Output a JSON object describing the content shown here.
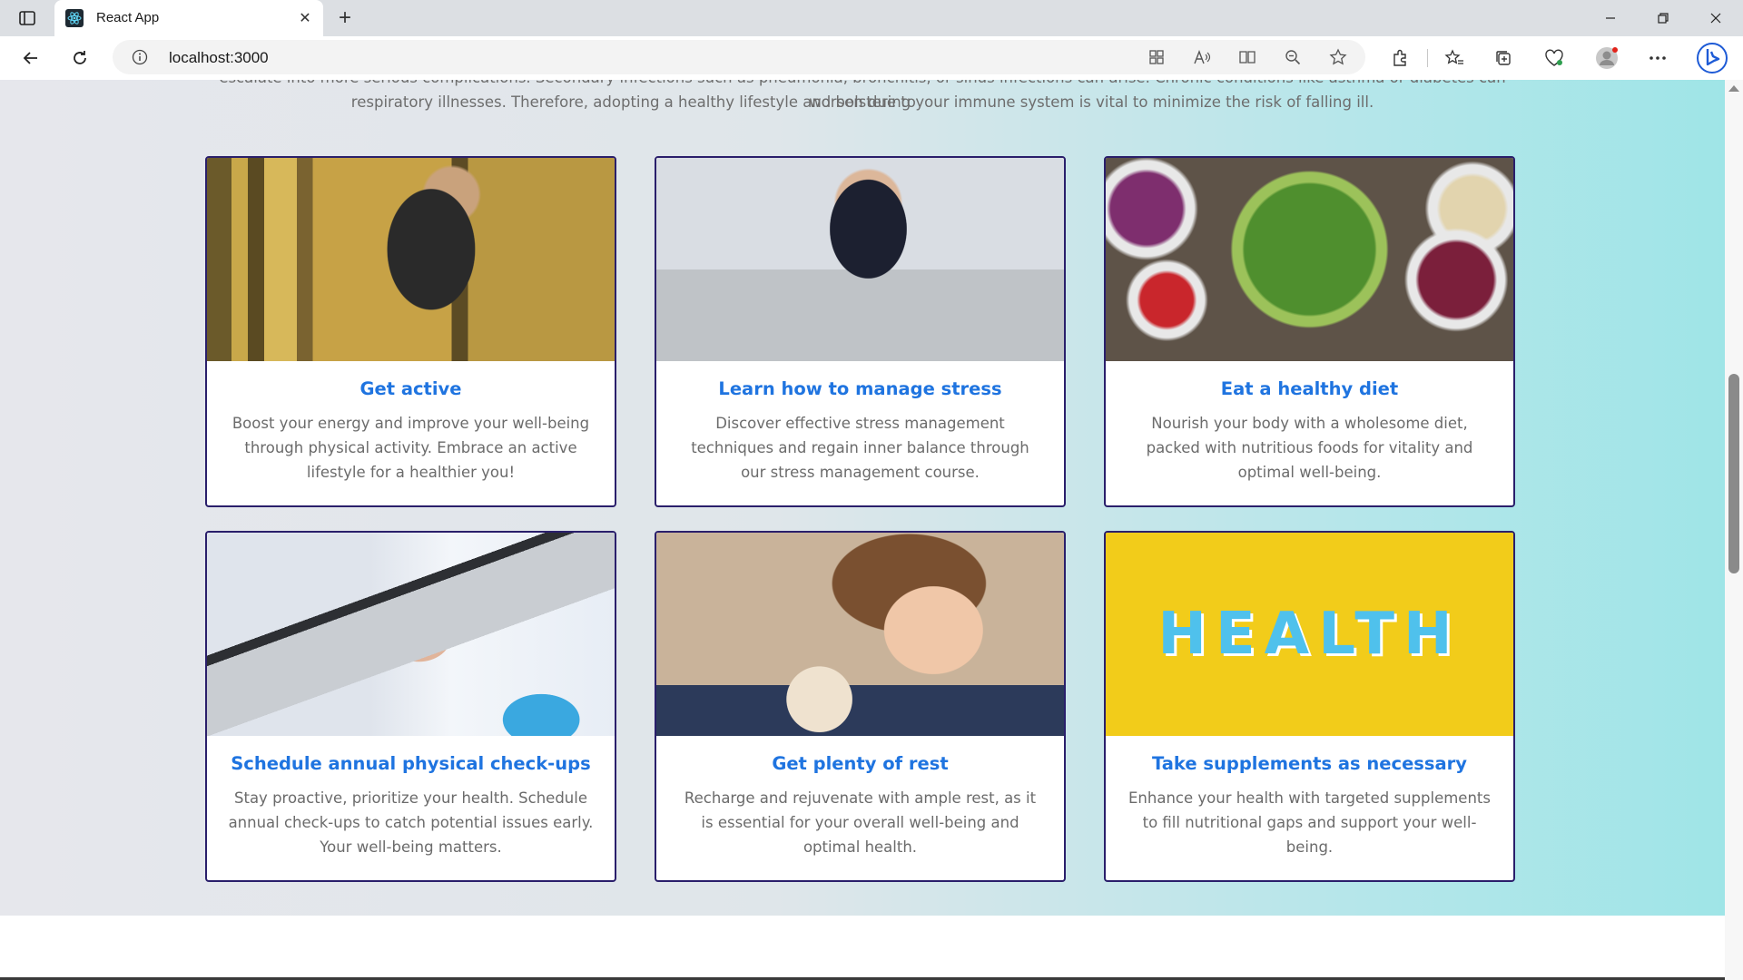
{
  "browser": {
    "tab_title": "React App",
    "url": "localhost:3000",
    "new_tab_symbol": "+",
    "close_symbol": "✕"
  },
  "page": {
    "intro_cut": "escalate into more serious complications. Secondary infections such as pneumonia, bronchitis, or sinus infections can arise. Chronic conditions like asthma or diabetes can worsen due to",
    "intro_line": "respiratory illnesses. Therefore, adopting a healthy lifestyle and bolstering your immune system is vital to minimize the risk of falling ill.",
    "cards": [
      {
        "title": "Get active",
        "text": "Boost your energy and improve your well-being through physical activity. Embrace an active lifestyle for a healthier you!"
      },
      {
        "title": "Learn how to manage stress",
        "text": "Discover effective stress management techniques and regain inner balance through our stress management course."
      },
      {
        "title": "Eat a healthy diet",
        "text": "Nourish your body with a wholesome diet, packed with nutritious foods for vitality and optimal well-being."
      },
      {
        "title": "Schedule annual physical check-ups",
        "text": "Stay proactive, prioritize your health. Schedule annual check-ups to catch potential issues early. Your well-being matters."
      },
      {
        "title": "Get plenty of rest",
        "text": "Recharge and rejuvenate with ample rest, as it is essential for your overall well-being and optimal health."
      },
      {
        "title": "Take supplements as necessary",
        "text": "Enhance your health with targeted supplements to fill nutritional gaps and support your well-being.",
        "image_word": "HEALTH"
      }
    ]
  },
  "colors": {
    "card_title": "#1f74e0",
    "card_border": "#2a1f6b",
    "body_text": "#6b6b6b"
  }
}
